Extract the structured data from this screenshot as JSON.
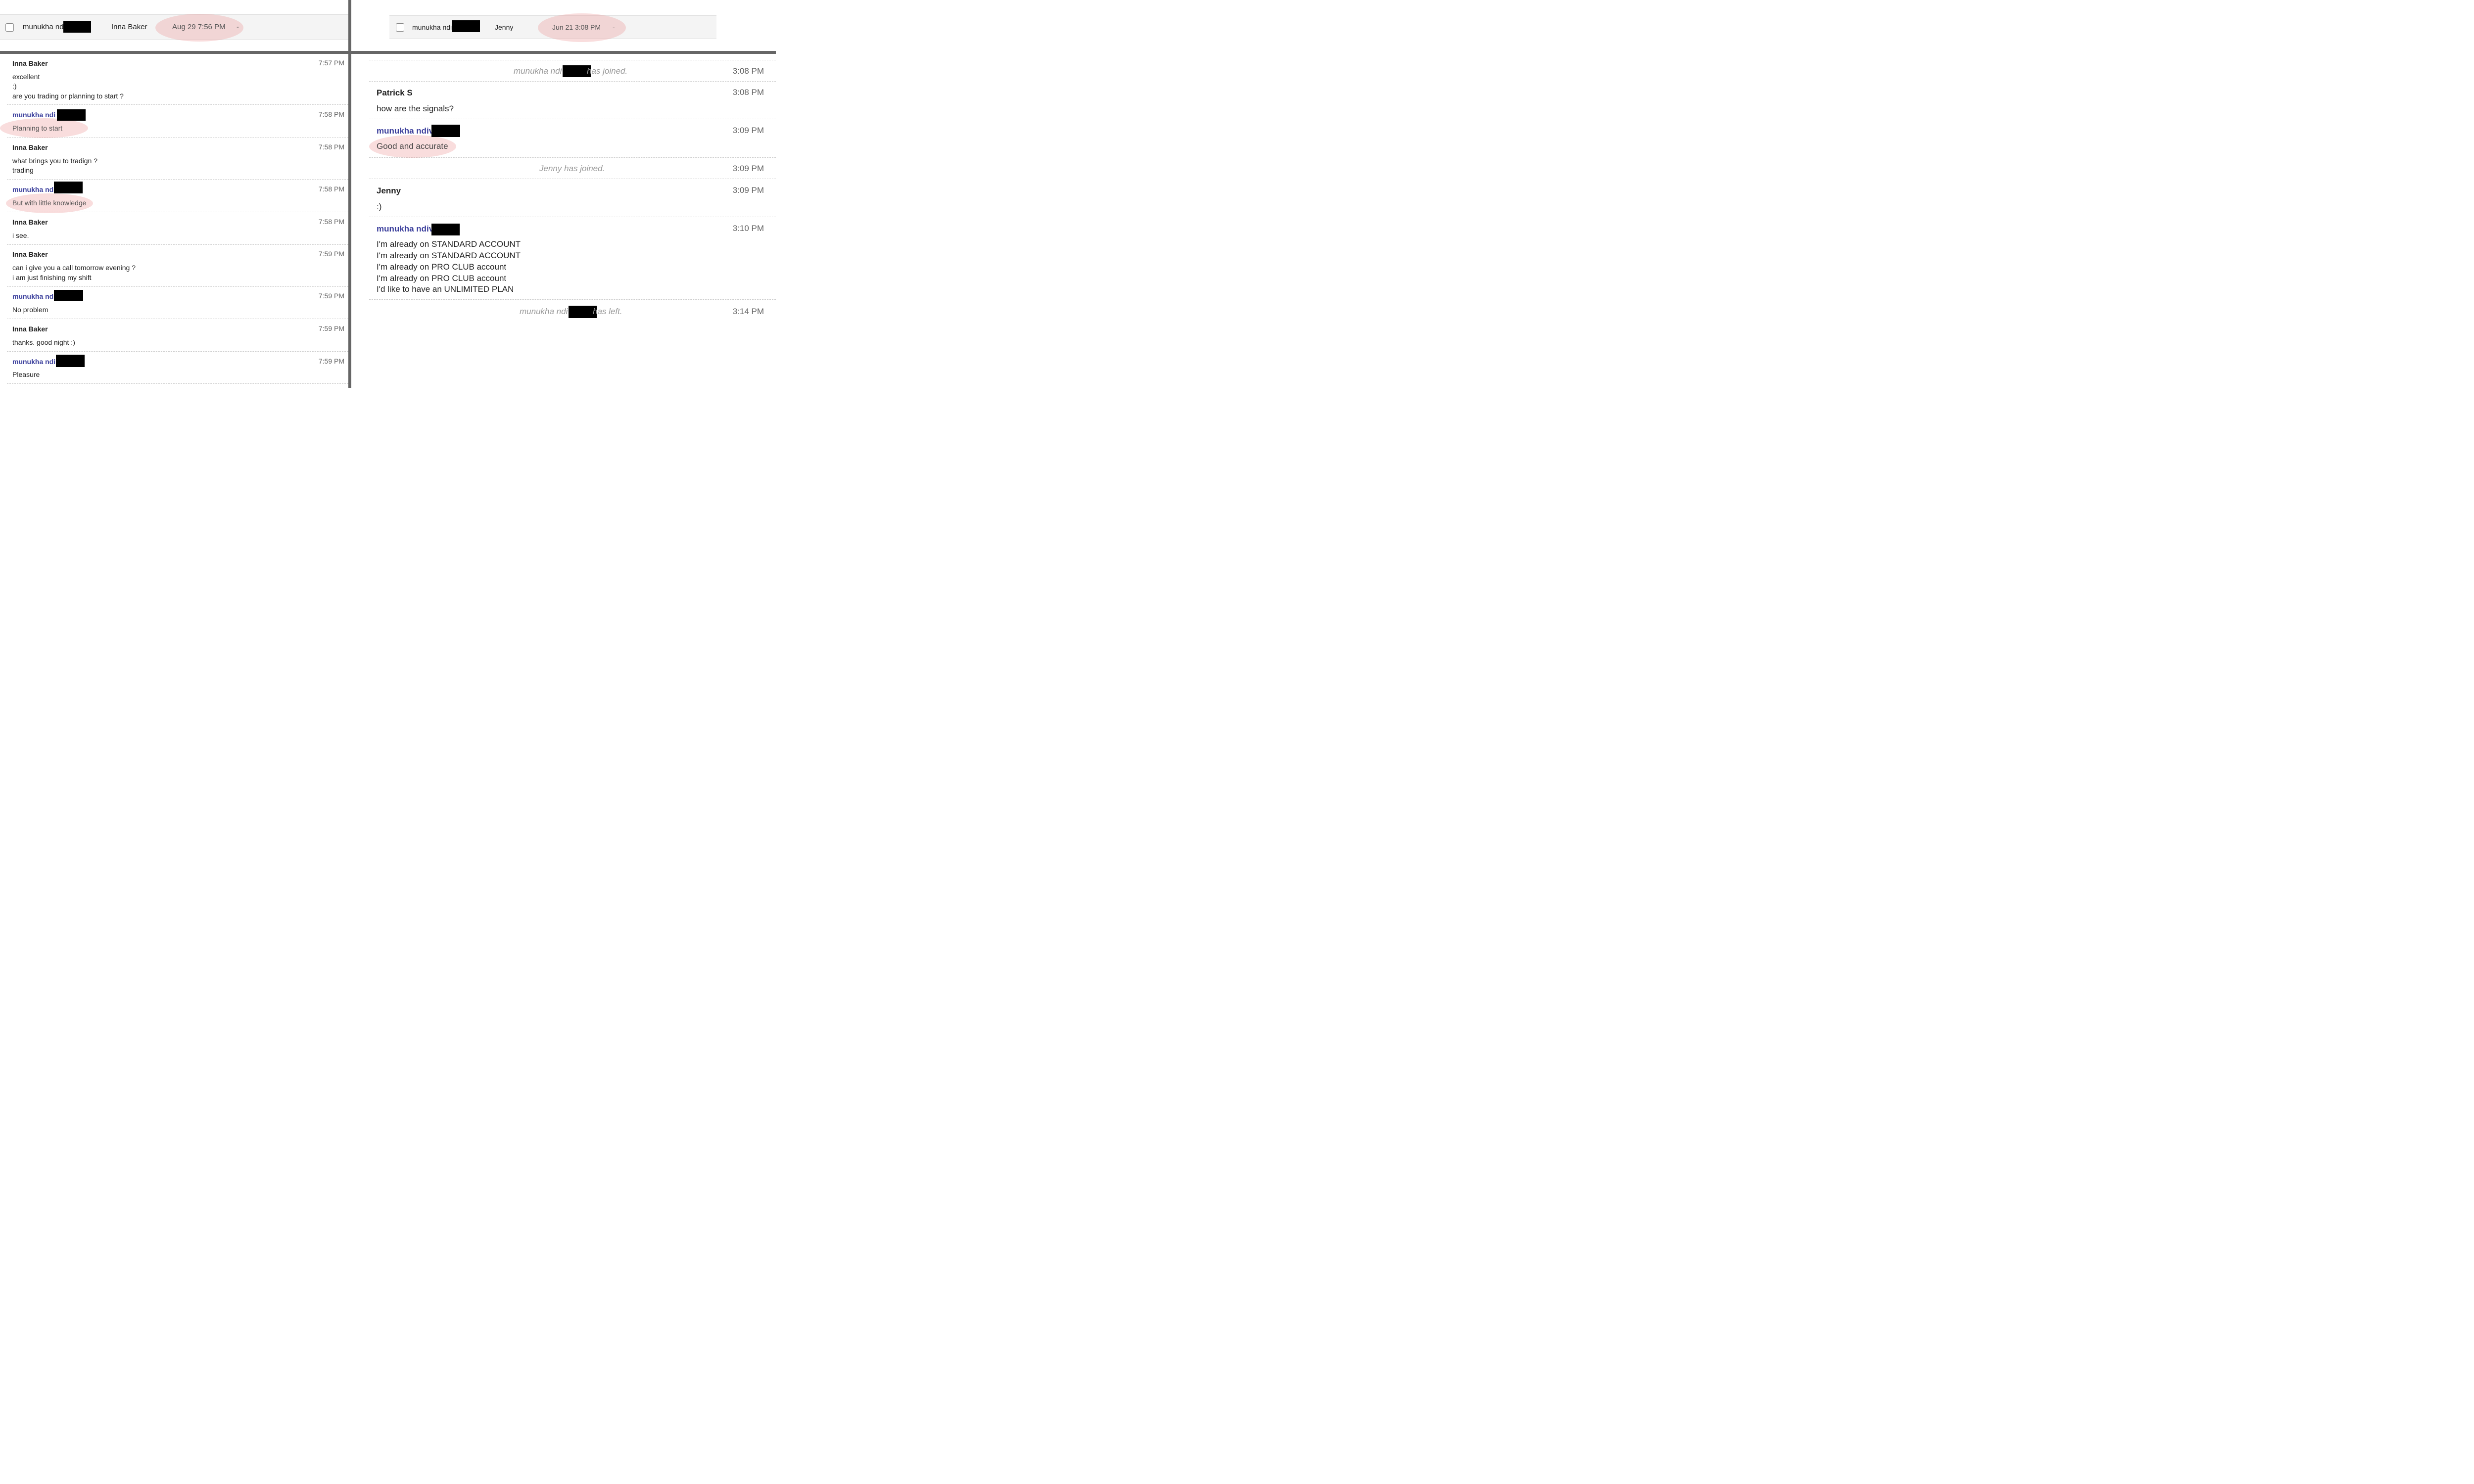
{
  "left_header": {
    "contact": "munukha nd",
    "agent": "Inna Baker",
    "started": "Aug 29 7:56 PM",
    "dash": "-"
  },
  "right_header": {
    "contact": "munukha ndi",
    "agent": "Jenny",
    "started": "Jun 21 3:08 PM",
    "dash": "-"
  },
  "left_chat": [
    {
      "sender": "Inna Baker",
      "time": "7:57 PM",
      "lines": [
        "excellent",
        ":)",
        "are you trading or planning to start ?"
      ]
    },
    {
      "sender": "munukha ndi",
      "time": "7:58 PM",
      "lines": [
        "Planning to start"
      ]
    },
    {
      "sender": "Inna Baker",
      "time": "7:58 PM",
      "lines": [
        "what brings you to tradign ?",
        "trading"
      ]
    },
    {
      "sender": "munukha nd",
      "time": "7:58 PM",
      "lines": [
        "But with little knowledge"
      ]
    },
    {
      "sender": "Inna Baker",
      "time": "7:58 PM",
      "lines": [
        "i see."
      ]
    },
    {
      "sender": "Inna Baker",
      "time": "7:59 PM",
      "lines": [
        "can i give you a call tomorrow evening ?",
        "i am just finishing my shift"
      ]
    },
    {
      "sender": "munukha nd",
      "time": "7:59 PM",
      "lines": [
        "No problem"
      ]
    },
    {
      "sender": "Inna Baker",
      "time": "7:59 PM",
      "lines": [
        "thanks. good night :)"
      ]
    },
    {
      "sender": "munukha ndi",
      "time": "7:59 PM",
      "lines": [
        "Pleasure"
      ]
    }
  ],
  "right_chat": {
    "joined1": {
      "prefix": "munukha ndi",
      "suffix": "has joined.",
      "time": "3:08 PM"
    },
    "m1": {
      "sender": "Patrick S",
      "time": "3:08 PM",
      "lines": [
        "how are the signals?"
      ]
    },
    "m2": {
      "sender": "munukha ndiv",
      "time": "3:09 PM",
      "lines": [
        "Good and accurate"
      ]
    },
    "joined2": {
      "text": "Jenny has joined.",
      "time": "3:09 PM"
    },
    "m3": {
      "sender": "Jenny",
      "time": "3:09 PM",
      "lines": [
        ":)"
      ]
    },
    "m4": {
      "sender": "munukha ndiv",
      "time": "3:10 PM",
      "lines": [
        "I'm already on STANDARD ACCOUNT",
        "I'm already on STANDARD ACCOUNT",
        "I'm already on PRO CLUB account",
        "I'm already on PRO CLUB account",
        "I'd like to have an UNLIMITED PLAN"
      ]
    },
    "left1": {
      "prefix": "munukha ndi",
      "suffix": "has left.",
      "time": "3:14 PM"
    }
  },
  "colors": {
    "own_sender": "#3b3f9c",
    "highlight": "#eb9696",
    "divider": "#666666"
  },
  "icons": [
    "checkbox-icon"
  ]
}
